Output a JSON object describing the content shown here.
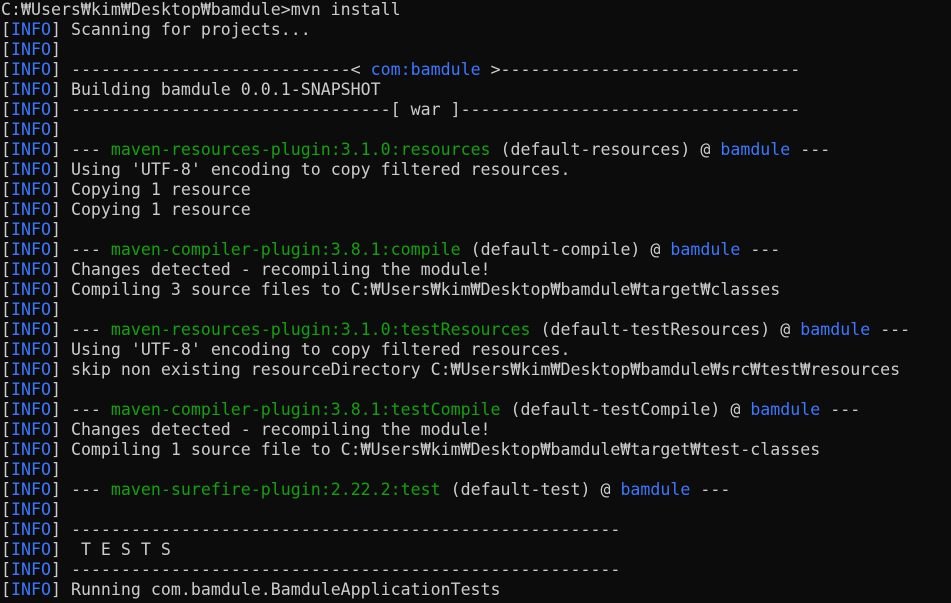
{
  "colors": {
    "background": "#0c0c0c",
    "text": "#cccccc",
    "info": "#3b78ff",
    "plugin": "#13a10e",
    "project": "#3b78ff"
  },
  "terminal": {
    "lines": [
      [
        {
          "t": "C:₩Users₩kim₩Desktop₩bamdule>mvn install",
          "c": "plain"
        }
      ],
      [
        {
          "t": "[",
          "c": "plain"
        },
        {
          "t": "INFO",
          "c": "blue"
        },
        {
          "t": "] Scanning for projects...",
          "c": "plain"
        }
      ],
      [
        {
          "t": "[",
          "c": "plain"
        },
        {
          "t": "INFO",
          "c": "blue"
        },
        {
          "t": "]",
          "c": "plain"
        }
      ],
      [
        {
          "t": "[",
          "c": "plain"
        },
        {
          "t": "INFO",
          "c": "blue"
        },
        {
          "t": "] ----------------------------< ",
          "c": "plain"
        },
        {
          "t": "com:bamdule",
          "c": "blue"
        },
        {
          "t": " >------------------------------",
          "c": "plain"
        }
      ],
      [
        {
          "t": "[",
          "c": "plain"
        },
        {
          "t": "INFO",
          "c": "blue"
        },
        {
          "t": "] Building bamdule 0.0.1-SNAPSHOT",
          "c": "plain"
        }
      ],
      [
        {
          "t": "[",
          "c": "plain"
        },
        {
          "t": "INFO",
          "c": "blue"
        },
        {
          "t": "] --------------------------------[ war ]----------------------------------",
          "c": "plain"
        }
      ],
      [
        {
          "t": "[",
          "c": "plain"
        },
        {
          "t": "INFO",
          "c": "blue"
        },
        {
          "t": "]",
          "c": "plain"
        }
      ],
      [
        {
          "t": "[",
          "c": "plain"
        },
        {
          "t": "INFO",
          "c": "blue"
        },
        {
          "t": "] --- ",
          "c": "plain"
        },
        {
          "t": "maven-resources-plugin:3.1.0:resources",
          "c": "green"
        },
        {
          "t": " (default-resources) @ ",
          "c": "plain"
        },
        {
          "t": "bamdule",
          "c": "blue"
        },
        {
          "t": " ---",
          "c": "plain"
        }
      ],
      [
        {
          "t": "[",
          "c": "plain"
        },
        {
          "t": "INFO",
          "c": "blue"
        },
        {
          "t": "] Using 'UTF-8' encoding to copy filtered resources.",
          "c": "plain"
        }
      ],
      [
        {
          "t": "[",
          "c": "plain"
        },
        {
          "t": "INFO",
          "c": "blue"
        },
        {
          "t": "] Copying 1 resource",
          "c": "plain"
        }
      ],
      [
        {
          "t": "[",
          "c": "plain"
        },
        {
          "t": "INFO",
          "c": "blue"
        },
        {
          "t": "] Copying 1 resource",
          "c": "plain"
        }
      ],
      [
        {
          "t": "[",
          "c": "plain"
        },
        {
          "t": "INFO",
          "c": "blue"
        },
        {
          "t": "]",
          "c": "plain"
        }
      ],
      [
        {
          "t": "[",
          "c": "plain"
        },
        {
          "t": "INFO",
          "c": "blue"
        },
        {
          "t": "] --- ",
          "c": "plain"
        },
        {
          "t": "maven-compiler-plugin:3.8.1:compile",
          "c": "green"
        },
        {
          "t": " (default-compile) @ ",
          "c": "plain"
        },
        {
          "t": "bamdule",
          "c": "blue"
        },
        {
          "t": " ---",
          "c": "plain"
        }
      ],
      [
        {
          "t": "[",
          "c": "plain"
        },
        {
          "t": "INFO",
          "c": "blue"
        },
        {
          "t": "] Changes detected - recompiling the module!",
          "c": "plain"
        }
      ],
      [
        {
          "t": "[",
          "c": "plain"
        },
        {
          "t": "INFO",
          "c": "blue"
        },
        {
          "t": "] Compiling 3 source files to C:₩Users₩kim₩Desktop₩bamdule₩target₩classes",
          "c": "plain"
        }
      ],
      [
        {
          "t": "[",
          "c": "plain"
        },
        {
          "t": "INFO",
          "c": "blue"
        },
        {
          "t": "]",
          "c": "plain"
        }
      ],
      [
        {
          "t": "[",
          "c": "plain"
        },
        {
          "t": "INFO",
          "c": "blue"
        },
        {
          "t": "] --- ",
          "c": "plain"
        },
        {
          "t": "maven-resources-plugin:3.1.0:testResources",
          "c": "green"
        },
        {
          "t": " (default-testResources) @ ",
          "c": "plain"
        },
        {
          "t": "bamdule",
          "c": "blue"
        },
        {
          "t": " ---",
          "c": "plain"
        }
      ],
      [
        {
          "t": "[",
          "c": "plain"
        },
        {
          "t": "INFO",
          "c": "blue"
        },
        {
          "t": "] Using 'UTF-8' encoding to copy filtered resources.",
          "c": "plain"
        }
      ],
      [
        {
          "t": "[",
          "c": "plain"
        },
        {
          "t": "INFO",
          "c": "blue"
        },
        {
          "t": "] skip non existing resourceDirectory C:₩Users₩kim₩Desktop₩bamdule₩src₩test₩resources",
          "c": "plain"
        }
      ],
      [
        {
          "t": "[",
          "c": "plain"
        },
        {
          "t": "INFO",
          "c": "blue"
        },
        {
          "t": "]",
          "c": "plain"
        }
      ],
      [
        {
          "t": "[",
          "c": "plain"
        },
        {
          "t": "INFO",
          "c": "blue"
        },
        {
          "t": "] --- ",
          "c": "plain"
        },
        {
          "t": "maven-compiler-plugin:3.8.1:testCompile",
          "c": "green"
        },
        {
          "t": " (default-testCompile) @ ",
          "c": "plain"
        },
        {
          "t": "bamdule",
          "c": "blue"
        },
        {
          "t": " ---",
          "c": "plain"
        }
      ],
      [
        {
          "t": "[",
          "c": "plain"
        },
        {
          "t": "INFO",
          "c": "blue"
        },
        {
          "t": "] Changes detected - recompiling the module!",
          "c": "plain"
        }
      ],
      [
        {
          "t": "[",
          "c": "plain"
        },
        {
          "t": "INFO",
          "c": "blue"
        },
        {
          "t": "] Compiling 1 source file to C:₩Users₩kim₩Desktop₩bamdule₩target₩test-classes",
          "c": "plain"
        }
      ],
      [
        {
          "t": "[",
          "c": "plain"
        },
        {
          "t": "INFO",
          "c": "blue"
        },
        {
          "t": "]",
          "c": "plain"
        }
      ],
      [
        {
          "t": "[",
          "c": "plain"
        },
        {
          "t": "INFO",
          "c": "blue"
        },
        {
          "t": "] --- ",
          "c": "plain"
        },
        {
          "t": "maven-surefire-plugin:2.22.2:test",
          "c": "green"
        },
        {
          "t": " (default-test) @ ",
          "c": "plain"
        },
        {
          "t": "bamdule",
          "c": "blue"
        },
        {
          "t": " ---",
          "c": "plain"
        }
      ],
      [
        {
          "t": "[",
          "c": "plain"
        },
        {
          "t": "INFO",
          "c": "blue"
        },
        {
          "t": "]",
          "c": "plain"
        }
      ],
      [
        {
          "t": "[",
          "c": "plain"
        },
        {
          "t": "INFO",
          "c": "blue"
        },
        {
          "t": "] -------------------------------------------------------",
          "c": "plain"
        }
      ],
      [
        {
          "t": "[",
          "c": "plain"
        },
        {
          "t": "INFO",
          "c": "blue"
        },
        {
          "t": "]  T E S T S",
          "c": "plain"
        }
      ],
      [
        {
          "t": "[",
          "c": "plain"
        },
        {
          "t": "INFO",
          "c": "blue"
        },
        {
          "t": "] -------------------------------------------------------",
          "c": "plain"
        }
      ],
      [
        {
          "t": "[",
          "c": "plain"
        },
        {
          "t": "INFO",
          "c": "blue"
        },
        {
          "t": "] Running com.bamdule.BamduleApplicationTests",
          "c": "plain"
        }
      ]
    ]
  }
}
